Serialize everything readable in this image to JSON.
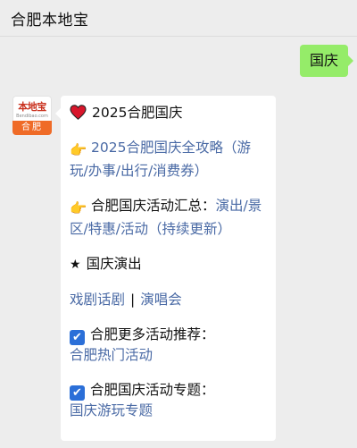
{
  "header": {
    "title": "合肥本地宝"
  },
  "user_message": "国庆",
  "avatar": {
    "logo_text": "本地宝",
    "logo_sub": "Bendibao.com",
    "band_text": "合肥"
  },
  "reply": {
    "headline": "2025合肥国庆",
    "guide_link": "2025合肥国庆全攻略（游玩/办事/出行/消费券）",
    "activity_prefix": "合肥国庆活动汇总：",
    "activity_link": "演出/景区/特惠/活动（持续更新）",
    "shows_title": "国庆演出",
    "drama_link": "戏剧话剧",
    "separator": "|",
    "concert_link": "演唱会",
    "more_title": "合肥更多活动推荐：",
    "hot_link": "合肥热门活动",
    "topic_title": "合肥国庆活动专题：",
    "topic_link": "国庆游玩专题"
  },
  "colors": {
    "user_bubble": "#95ec69",
    "link": "#4a6aa5",
    "check": "#2b6fd8",
    "heart": "#d8162b"
  }
}
